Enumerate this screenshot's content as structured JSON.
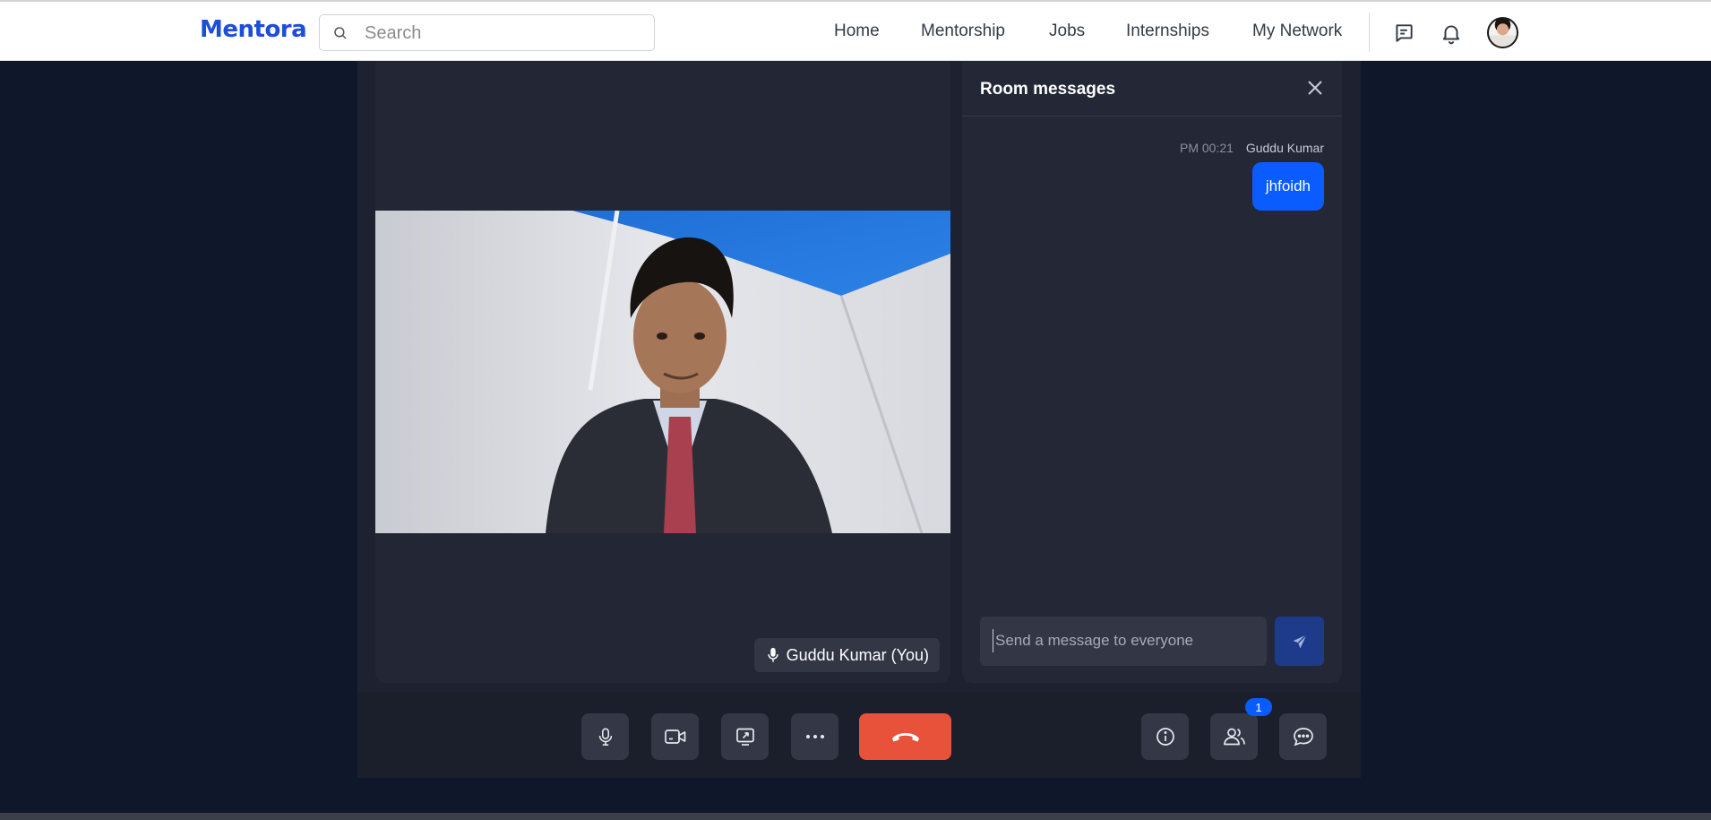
{
  "app": {
    "logo": "Mentora"
  },
  "search": {
    "placeholder": "Search"
  },
  "nav": {
    "items": [
      "Home",
      "Mentorship",
      "Jobs",
      "Internships",
      "My Network"
    ]
  },
  "header_icons": [
    "messages-icon",
    "bell-icon",
    "avatar"
  ],
  "video": {
    "participant_label": "Guddu Kumar (You)"
  },
  "chat": {
    "title": "Room messages",
    "messages": [
      {
        "time": "PM 00:21",
        "sender": "Guddu Kumar",
        "text": "jhfoidh"
      }
    ],
    "input_placeholder": "Send a message to everyone"
  },
  "controls": {
    "left": [
      "microphone-icon",
      "camera-icon",
      "share-screen-icon",
      "more-icon"
    ],
    "end_call": "phone-hangup-icon",
    "right": [
      "info-icon",
      "participants-icon",
      "chat-icon"
    ],
    "participants_badge": "1"
  },
  "colors": {
    "brand": "#1d4ed8",
    "background": "#0f172a",
    "end_call": "#e8513a",
    "accent": "#0b5cff"
  }
}
